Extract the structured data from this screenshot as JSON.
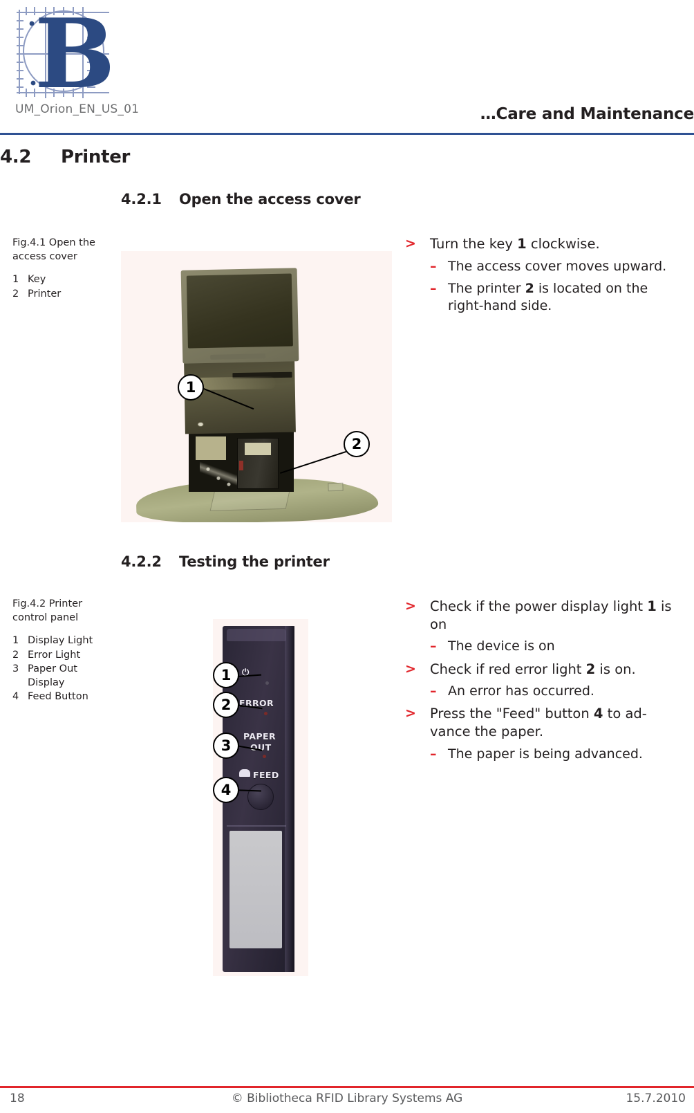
{
  "header": {
    "doc_code": "UM_Orion_EN_US_01",
    "title": "…Care and Maintenance",
    "logo_letter": "B",
    "rule_color": "#2f5193"
  },
  "section": {
    "number": "4.2",
    "title": "Printer"
  },
  "subsections": [
    {
      "number": "4.2.1",
      "title": "Open the access cover",
      "figure": {
        "caption": "Fig.4.1 Open the access cover",
        "legend": [
          {
            "num": "1",
            "label": "Key"
          },
          {
            "num": "2",
            "label": "Printer"
          }
        ],
        "callouts": [
          "1",
          "2"
        ]
      },
      "steps": [
        {
          "marker": ">",
          "text_parts": [
            {
              "t": "Turn the key ",
              "bold": false
            },
            {
              "t": "1",
              "bold": true
            },
            {
              "t": " clockwise.",
              "bold": false
            }
          ],
          "subs": [
            {
              "marker": "–",
              "text_parts": [
                {
                  "t": "The access cover moves upward.",
                  "bold": false
                }
              ]
            },
            {
              "marker": "–",
              "text_parts": [
                {
                  "t": "The printer ",
                  "bold": false
                },
                {
                  "t": "2",
                  "bold": true
                },
                {
                  "t": " is located on the right-hand side.",
                  "bold": false
                }
              ]
            }
          ]
        }
      ]
    },
    {
      "number": "4.2.2",
      "title": "Testing the printer",
      "figure": {
        "caption": "Fig.4.2 Printer control panel",
        "legend": [
          {
            "num": "1",
            "label": "Display Light"
          },
          {
            "num": "2",
            "label": "Error Light"
          },
          {
            "num": "3",
            "label": "Paper Out Display"
          },
          {
            "num": "4",
            "label": "Feed Button"
          }
        ],
        "callouts": [
          "1",
          "2",
          "3",
          "4"
        ],
        "panel_labels": {
          "power": "⏻",
          "error": "ERROR",
          "paper_out_line1": "PAPER",
          "paper_out_line2": "OUT",
          "feed": "FEED"
        }
      },
      "steps": [
        {
          "marker": ">",
          "text_parts": [
            {
              "t": "Check if the power display light ",
              "bold": false
            },
            {
              "t": "1",
              "bold": true
            },
            {
              "t": " is on",
              "bold": false
            }
          ],
          "subs": [
            {
              "marker": "–",
              "text_parts": [
                {
                  "t": "The device is on",
                  "bold": false
                }
              ]
            }
          ]
        },
        {
          "marker": ">",
          "text_parts": [
            {
              "t": "Check if red error light ",
              "bold": false
            },
            {
              "t": "2",
              "bold": true
            },
            {
              "t": " is on.",
              "bold": false
            }
          ],
          "subs": [
            {
              "marker": "–",
              "text_parts": [
                {
                  "t": "An error has occurred.",
                  "bold": false
                }
              ]
            }
          ]
        },
        {
          "marker": ">",
          "text_parts": [
            {
              "t": "Press the \"Feed\" button ",
              "bold": false
            },
            {
              "t": "4",
              "bold": true
            },
            {
              "t": " to ad-vance the paper.",
              "bold": false
            }
          ],
          "subs": [
            {
              "marker": "–",
              "text_parts": [
                {
                  "t": "The paper is being advanced.",
                  "bold": false
                }
              ]
            }
          ]
        }
      ]
    }
  ],
  "footer": {
    "page_number": "18",
    "copyright": "© Bibliotheca RFID Library Systems AG",
    "date": "15.7.2010",
    "rule_color": "#e1252b"
  },
  "colors": {
    "accent_red": "#e1252b",
    "accent_blue": "#2f5193",
    "text": "#231f20",
    "muted": "#6d6e70"
  }
}
